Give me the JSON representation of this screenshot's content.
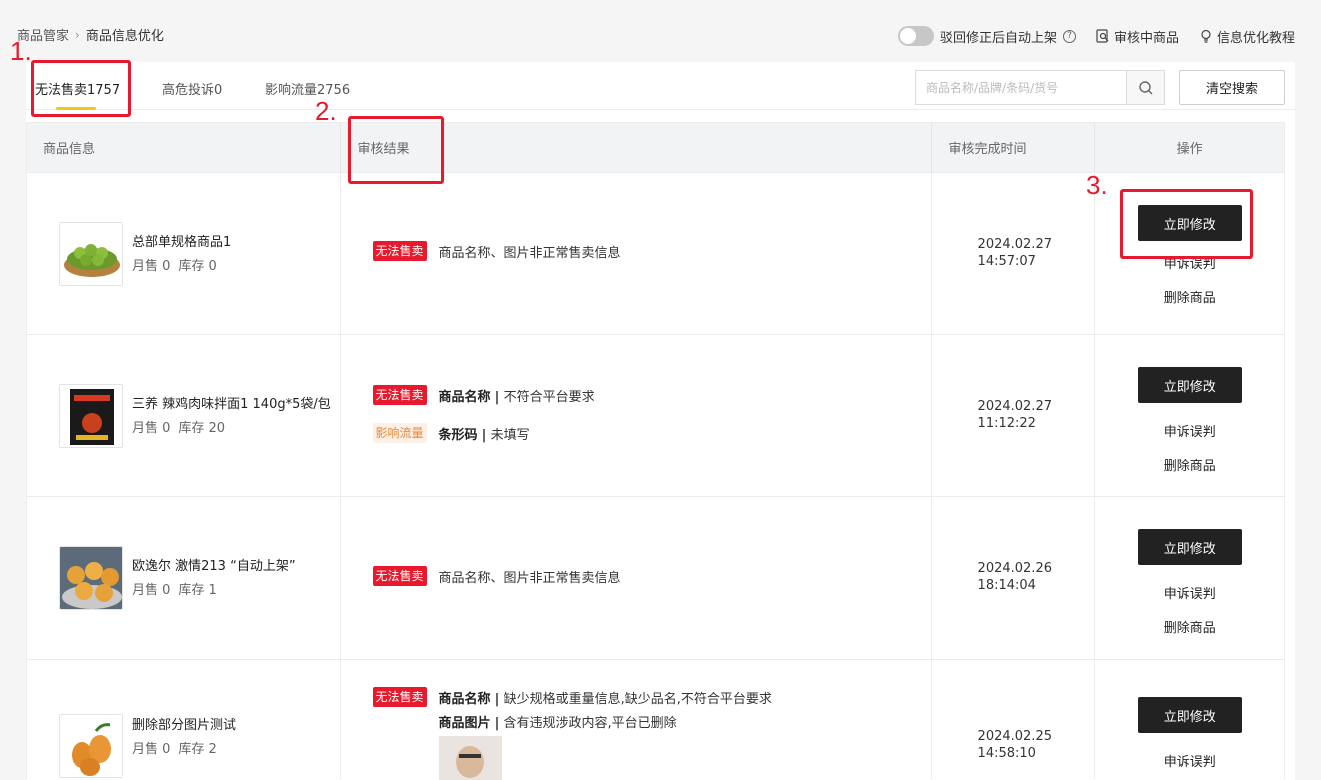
{
  "breadcrumb": {
    "root": "商品管家",
    "current": "商品信息优化"
  },
  "top_actions": {
    "toggle_label": "驳回修正后自动上架",
    "toggle_on": false,
    "review_label": "审核中商品",
    "tutorial_label": "信息优化教程"
  },
  "tabs": [
    {
      "label": "无法售卖1757",
      "active": true
    },
    {
      "label": "高危投诉0",
      "active": false
    },
    {
      "label": "影响流量2756",
      "active": false
    }
  ],
  "search": {
    "placeholder": "商品名称/品牌/条码/货号",
    "value": ""
  },
  "clear_button": "清空搜索",
  "table": {
    "headers": [
      "商品信息",
      "审核结果",
      "审核完成时间",
      "操作"
    ],
    "rows": [
      {
        "name": "总部单规格商品1",
        "sales": "月售 0",
        "stock": "库存 0",
        "issues": [
          {
            "badge": "无法售卖",
            "field": "",
            "text": "商品名称、图片非正常售卖信息"
          }
        ],
        "date": "2024.02.27",
        "time": "14:57:07",
        "ops": [
          "立即修改",
          "申诉误判",
          "删除商品"
        ]
      },
      {
        "name": "三养 辣鸡肉味拌面1 140g*5袋/包",
        "sales": "月售 0",
        "stock": "库存 20",
        "issues": [
          {
            "badge": "无法售卖",
            "field": "商品名称",
            "text": "不符合平台要求"
          },
          {
            "badge": "影响流量",
            "field": "条形码",
            "text": "未填写"
          }
        ],
        "date": "2024.02.27",
        "time": "11:12:22",
        "ops": [
          "立即修改",
          "申诉误判",
          "删除商品"
        ]
      },
      {
        "name": "欧逸尔 激情213 “自动上架”",
        "sales": "月售 0",
        "stock": "库存 1",
        "issues": [
          {
            "badge": "无法售卖",
            "field": "",
            "text": "商品名称、图片非正常售卖信息"
          }
        ],
        "date": "2024.02.26",
        "time": "18:14:04",
        "ops": [
          "立即修改",
          "申诉误判",
          "删除商品"
        ]
      },
      {
        "name": "删除部分图片测试",
        "sales": "月售 0",
        "stock": "库存 2",
        "issues": [
          {
            "badge": "无法售卖",
            "field": "商品名称",
            "text": "缺少规格或重量信息,缺少品名,不符合平台要求"
          },
          {
            "badge": "",
            "field": "商品图片",
            "text": "含有违规涉政内容,平台已删除"
          }
        ],
        "date": "2024.02.25",
        "time": "14:58:10",
        "ops": [
          "立即修改",
          "申诉误判"
        ]
      }
    ]
  },
  "annotations": [
    "1.",
    "2.",
    "3."
  ],
  "colors": {
    "accent_red": "#e8192c",
    "tab_underline": "#f5c518",
    "primary_button": "#222222",
    "orange_badge": "#e8893a"
  }
}
